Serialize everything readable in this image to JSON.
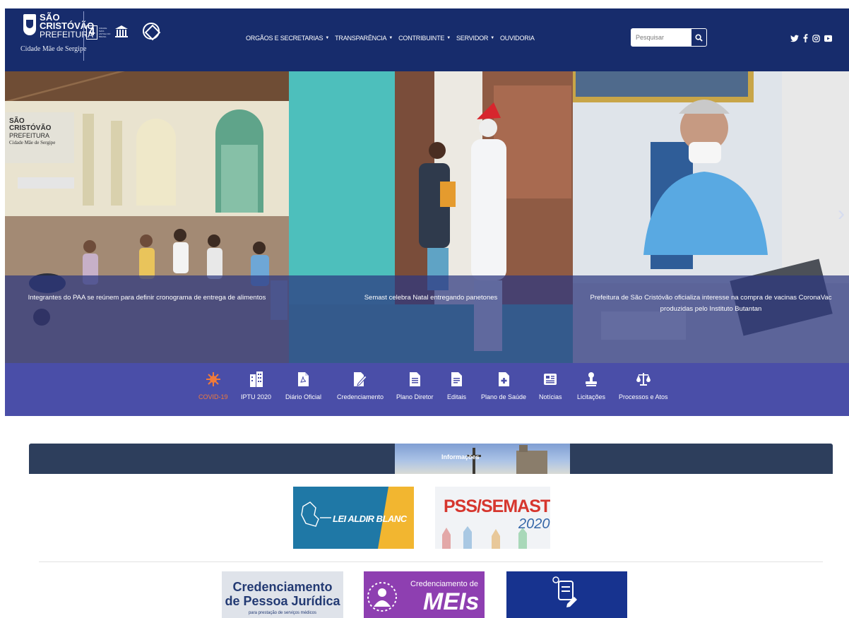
{
  "header": {
    "logo": {
      "line1": "SÃO",
      "line2": "CRISTÓVÃO",
      "line3": "PREFEITURA",
      "tagline": "Cidade Mãe de Sergipe",
      "badge_number": "4",
      "badge_text": "CIDADE MAIS ANTIGA DO BRASIL"
    },
    "nav": [
      {
        "label": "ORGÃOS E SECRETARIAS",
        "dropdown": true
      },
      {
        "label": "TRANSPARÊNCIA",
        "dropdown": true
      },
      {
        "label": "CONTRIBUINTE",
        "dropdown": true
      },
      {
        "label": "SERVIDOR",
        "dropdown": true
      },
      {
        "label": "OUVIDORIA",
        "dropdown": false
      }
    ],
    "search": {
      "placeholder": "Pesquisar",
      "icon": "search-icon"
    },
    "social": [
      "twitter-icon",
      "facebook-icon",
      "instagram-icon",
      "youtube-icon"
    ],
    "colors": {
      "bar": "#172c6c"
    }
  },
  "carousel": {
    "slides": [
      {
        "caption": "Integrantes do PAA se reúnem para definir cronograma de entrega de alimentos"
      },
      {
        "caption": "Semast celebra Natal entregando panetones"
      },
      {
        "caption": "Prefeitura de São Cristóvão oficializa interesse na compra de vacinas CoronaVac produzidas pelo Instituto Butantan"
      }
    ],
    "next_icon": "chevron-right-icon",
    "photo_sign": {
      "line1": "SÃO",
      "line2": "CRISTÓVÃO",
      "line3": "PREFEITURA",
      "line4": "Cidade Mãe de Sergipe"
    }
  },
  "quick_links": [
    {
      "label": "COVID-19",
      "icon": "virus-icon",
      "active": true
    },
    {
      "label": "IPTU 2020",
      "icon": "building-icon",
      "active": false
    },
    {
      "label": "Diário Oficial",
      "icon": "pdf-file-icon",
      "active": false
    },
    {
      "label": "Credenciamento",
      "icon": "signed-document-icon",
      "active": false
    },
    {
      "label": "Plano Diretor",
      "icon": "document-icon",
      "active": false
    },
    {
      "label": "Editais",
      "icon": "file-text-icon",
      "active": false
    },
    {
      "label": "Plano de Saúde",
      "icon": "medical-file-icon",
      "active": false
    },
    {
      "label": "Notícias",
      "icon": "newspaper-icon",
      "active": false
    },
    {
      "label": "Licitações",
      "icon": "stamp-icon",
      "active": false
    },
    {
      "label": "Processos e Atos",
      "icon": "scales-icon",
      "active": false
    }
  ],
  "info": {
    "title": "Informações",
    "banners": [
      {
        "text": "LEI ALDIR BLANC"
      },
      {
        "line1": "PSS/SEMAST",
        "line2": "2020"
      },
      {
        "line1": "Credenciamento",
        "line2": "de Pessoa Jurídica",
        "line3": "para prestação de serviços médicos"
      },
      {
        "line1": "Credenciamento de",
        "line2": "MEIs"
      },
      {
        "icon": "document-edit-icon"
      }
    ]
  },
  "colors": {
    "quick_bar": "#4a4ea8",
    "active_link": "#f07a3a",
    "caption_overlay": "#2c3880"
  }
}
